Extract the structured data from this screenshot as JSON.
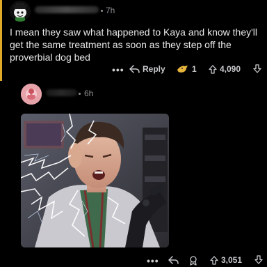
{
  "comment1": {
    "time": "7h",
    "body": "I mean they saw what happened to Kaya and know they'll get the same treatment as soon as they step off the proverbial dog bed",
    "actions": {
      "more_label": "•••",
      "reply_label": "Reply",
      "award_count": "1",
      "vote_count": "4,090"
    }
  },
  "comment2": {
    "time": "6h",
    "actions": {
      "more_label": "•••",
      "vote_count": "3,051"
    }
  },
  "colors": {
    "background": "#000000",
    "thread_line": "#e0a92a",
    "meta_text": "#8e9093",
    "body_text": "#e8e8e8",
    "avatar2_bg": "#e7a3aa"
  }
}
